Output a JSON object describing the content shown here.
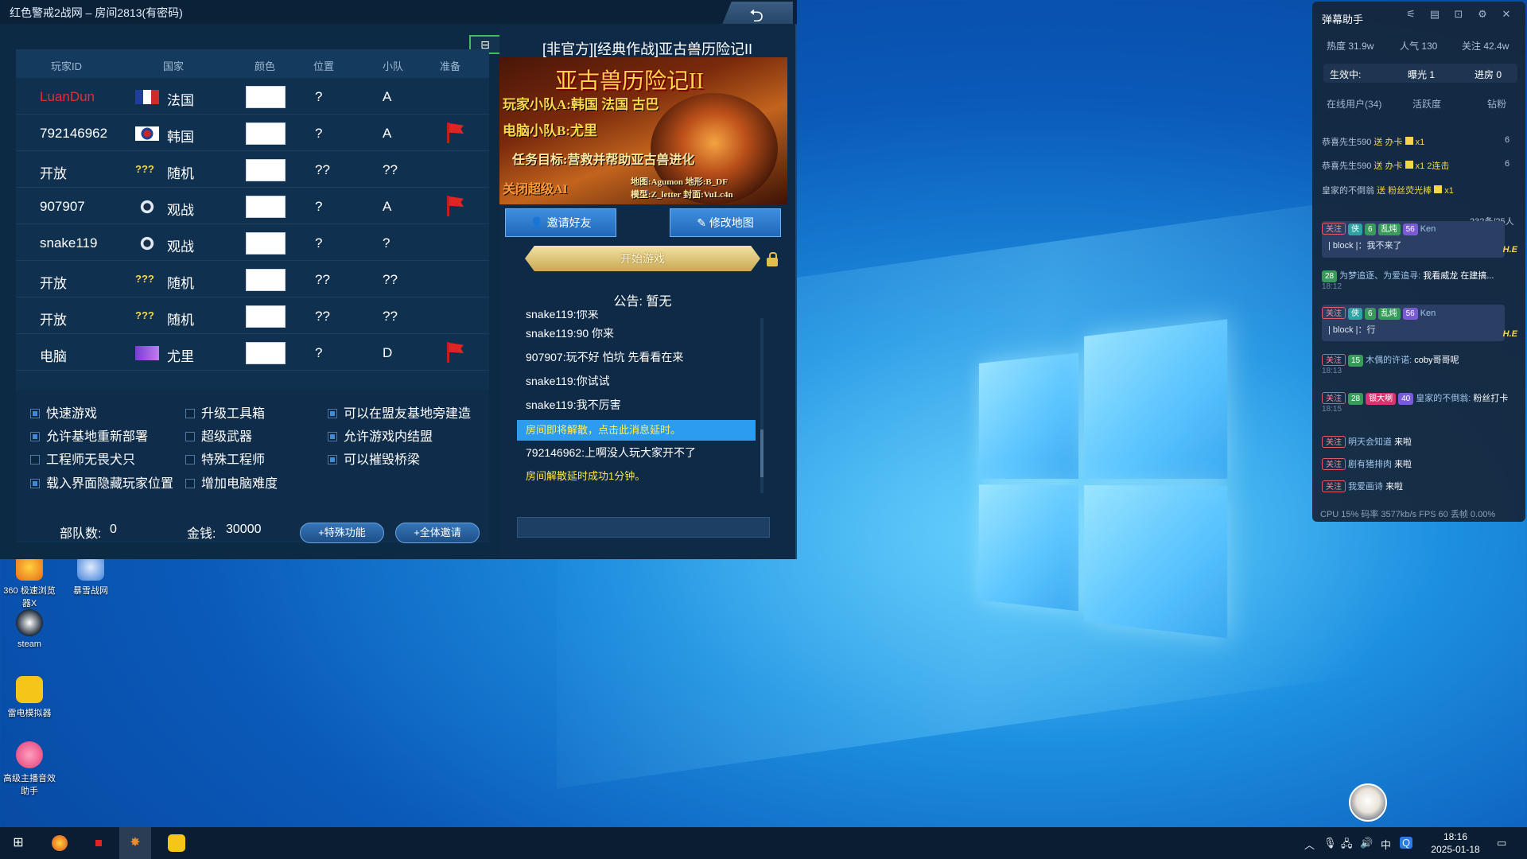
{
  "game_window": {
    "title": "红色警戒2战网 – 房间2813(有密码)",
    "back_icon": "return-arrow-icon",
    "table_headers": [
      "玩家ID",
      "国家",
      "颜色",
      "位置",
      "小队",
      "准备"
    ],
    "players": [
      {
        "id": "LuanDun",
        "flag": "france",
        "country": "法国",
        "position": "?",
        "team": "A",
        "ready": false,
        "id_color": "#e03030"
      },
      {
        "id": "792146962",
        "flag": "korea",
        "country": "韩国",
        "position": "?",
        "team": "A",
        "ready": true
      },
      {
        "id": "开放",
        "flag": "random",
        "country": "随机",
        "position": "??",
        "team": "??",
        "ready": false
      },
      {
        "id": "907907",
        "flag": "observer",
        "country": "观战",
        "position": "?",
        "team": "A",
        "ready": true
      },
      {
        "id": "snake119",
        "flag": "observer",
        "country": "观战",
        "position": "?",
        "team": "?",
        "ready": false
      },
      {
        "id": "开放",
        "flag": "random",
        "country": "随机",
        "position": "??",
        "team": "??",
        "ready": false
      },
      {
        "id": "开放",
        "flag": "random",
        "country": "随机",
        "position": "??",
        "team": "??",
        "ready": false
      },
      {
        "id": "电脑",
        "flag": "yuri",
        "country": "尤里",
        "position": "?",
        "team": "D",
        "ready": true
      }
    ],
    "options": [
      {
        "label": "快速游戏",
        "checked": true
      },
      {
        "label": "升级工具箱",
        "checked": false
      },
      {
        "label": "可以在盟友基地旁建造",
        "checked": true
      },
      {
        "label": "允许基地重新部署",
        "checked": true
      },
      {
        "label": "超级武器",
        "checked": false
      },
      {
        "label": "允许游戏内结盟",
        "checked": true
      },
      {
        "label": "工程师无畏犬只",
        "checked": false
      },
      {
        "label": "特殊工程师",
        "checked": false
      },
      {
        "label": "可以摧毁桥梁",
        "checked": true
      },
      {
        "label": "载入界面隐藏玩家位置",
        "checked": true
      },
      {
        "label": "增加电脑难度",
        "checked": false
      }
    ],
    "units_label": "部队数:",
    "units_value": "0",
    "money_label": "金钱:",
    "money_value": "30000",
    "special_button": "+特殊功能",
    "invite_all_button": "+全体邀请",
    "map_title": "[非官方][经典作战]亚古兽历险记II",
    "map_image": {
      "title": "亚古兽历险记II",
      "line1": "玩家小队A:韩国 法国 古巴",
      "line2": "电脑小队B:尤里",
      "line3": "任务目标:营救并帮助亚古兽进化",
      "line4": "关闭超级AI",
      "credit1": "地图:Agumon 地形:B_DF",
      "credit2": "模型:Z_letter 封面:VuLc4n"
    },
    "invite_friend_button": "邀请好友",
    "edit_map_button": "修改地图",
    "start_button": "开始游戏",
    "notice": "公告: 暂无",
    "chat": [
      {
        "text": "snake119:你来",
        "style": "normal"
      },
      {
        "text": "snake119:90 你来",
        "style": "normal"
      },
      {
        "text": "907907:玩不好 怕坑  先看看在来",
        "style": "normal"
      },
      {
        "text": "snake119:你试试",
        "style": "normal"
      },
      {
        "text": "snake119:我不厉害",
        "style": "normal"
      },
      {
        "text": "房间即将解散，点击此消息延时。",
        "style": "highlight"
      },
      {
        "text": "792146962:上啊没人玩大家开不了",
        "style": "normal"
      },
      {
        "text": "房间解散延时成功1分钟。",
        "style": "yellow"
      }
    ]
  },
  "desktop_icons": [
    {
      "label": "360 极速浏览器X",
      "icon": "browser-icon"
    },
    {
      "label": "暴雪战网",
      "icon": "battlenet-icon"
    },
    {
      "label": "steam",
      "icon": "steam-icon"
    },
    {
      "label": "雷电模拟器",
      "icon": "emulator-icon"
    },
    {
      "label": "高级主播音效助手",
      "icon": "audio-icon"
    }
  ],
  "danmu": {
    "title": "弹幕助手",
    "heat": "热度 31.9w",
    "popularity": "人气 130",
    "follows": "关注 42.4w",
    "active_label": "生效中:",
    "exposure": "曝光 1",
    "progress": "进房 0",
    "tabs": [
      "在线用户(34)",
      "活跃度",
      "钻粉"
    ],
    "gifts": [
      {
        "user": "恭喜先生590",
        "action": "送 办卡",
        "count": "x1",
        "extra": "",
        "num": "6"
      },
      {
        "user": "恭喜先生590",
        "action": "送 办卡",
        "count": "x1",
        "extra": "2连击",
        "num": "6"
      },
      {
        "user": "皇家的不倒翁",
        "action": "送 粉丝荧光棒",
        "count": "x1",
        "extra": "",
        "num": ""
      }
    ],
    "counter": "232条/25人",
    "messages": [
      {
        "tags": [
          "关注",
          "侠",
          "6",
          "乱炖",
          "56"
        ],
        "name": "Ken",
        "text": "| block |：我不来了",
        "suffix": "H.E"
      },
      {
        "tags": [
          "28"
        ],
        "name": "为梦追逐、为爱追寻:",
        "text": "我看威龙 在建搞...",
        "time": "18:12"
      },
      {
        "tags": [
          "关注",
          "侠",
          "6",
          "乱炖",
          "56"
        ],
        "name": "Ken",
        "text": "| block |：行",
        "suffix": "H.E"
      },
      {
        "tags": [
          "关注",
          "15"
        ],
        "name": "木偶的许诺:",
        "text": "coby哥哥呢",
        "time": "18:13"
      },
      {
        "tags": [
          "关注",
          "28",
          "银大喇",
          "40"
        ],
        "name": "皇家的不倒翁:",
        "text": "粉丝打卡",
        "time": "18:15"
      },
      {
        "tags": [
          "关注"
        ],
        "name": "明天会知道",
        "text": "来啦"
      },
      {
        "tags": [
          "关注"
        ],
        "name": "剧有猪排肉",
        "text": "来啦"
      },
      {
        "tags": [
          "关注"
        ],
        "name": "我爱画诗",
        "text": "来啦"
      }
    ],
    "perf": "CPU 15%  码率 3577kb/s  FPS 60  丢帧 0.00%"
  },
  "taskbar": {
    "ime": "中",
    "time": "18:16",
    "date": "2025-01-18"
  },
  "colors": {
    "accent_blue": "#2b9cef",
    "ready_flag": "#e02424",
    "gold": "#c9a852"
  }
}
